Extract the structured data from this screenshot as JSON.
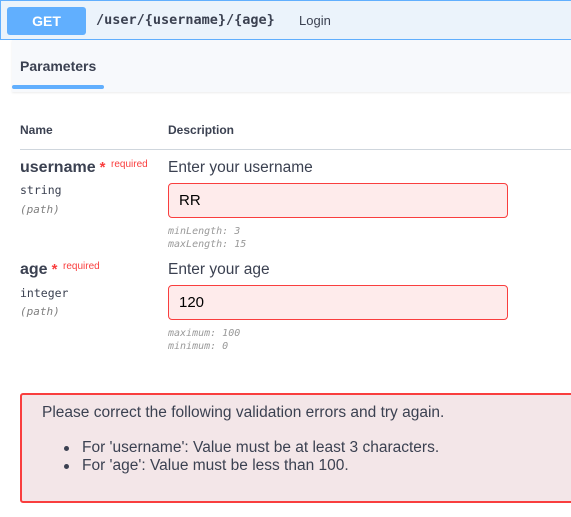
{
  "operation": {
    "method": "GET",
    "path": "/user/{username}/{age}",
    "summary": "Login"
  },
  "tab": {
    "label": "Parameters"
  },
  "columns": {
    "name": "Name",
    "description": "Description"
  },
  "params": [
    {
      "name": "username",
      "star": "*",
      "required": "required",
      "type": "string",
      "in": "(path)",
      "description": "Enter your username",
      "value": "RR",
      "constraints": [
        "minLength: 3",
        "maxLength: 15"
      ]
    },
    {
      "name": "age",
      "star": "*",
      "required": "required",
      "type": "integer",
      "in": "(path)",
      "description": "Enter your age",
      "value": "120",
      "constraints": [
        "maximum: 100",
        "minimum: 0"
      ]
    }
  ],
  "validation": {
    "message": "Please correct the following validation errors and try again.",
    "errors": [
      "For 'username': Value must be at least 3 characters.",
      "For 'age': Value must be less than 100."
    ]
  },
  "colors": {
    "method_blue": "#61affe",
    "error_red": "#f93e3e",
    "input_error_bg": "#feebeb",
    "error_box_bg": "#f3e6e8"
  }
}
